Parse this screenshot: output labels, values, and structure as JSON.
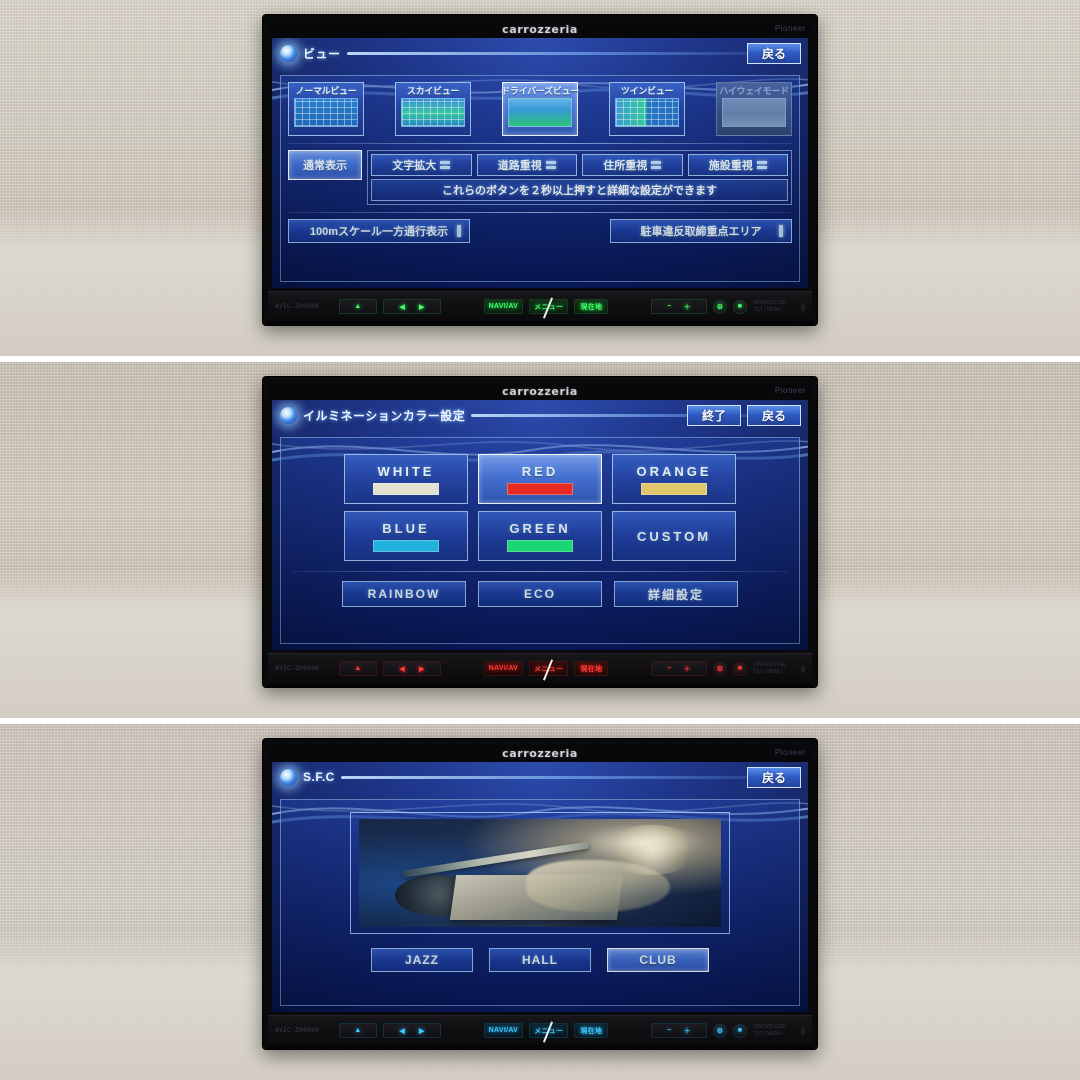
{
  "device": {
    "brand": "carrozzeria",
    "maker": "Pioneer",
    "model": "AVIC-ZH9000"
  },
  "faceplate": {
    "eject_label": "▲",
    "seek_back_label": "◀",
    "seek_fwd_label": "▶",
    "naviav_label": "NAVI/AV",
    "menu_label": "メニュー",
    "current_label": "現在地",
    "vol_down_label": "−",
    "vol_up_label": "＋",
    "round_a_label": "⚙",
    "round_b_label": "■",
    "tiny_text_1": "OPEN/CLOSE",
    "tiny_text_2": "TILT / MENU"
  },
  "panel1": {
    "title": "ビュー",
    "back_label": "戻る",
    "views": [
      {
        "label": "ノーマルビュー",
        "thumb": "th-normal",
        "state": "normal"
      },
      {
        "label": "スカイビュー",
        "thumb": "th-sky",
        "state": "normal"
      },
      {
        "label": "ドライバーズビュー",
        "thumb": "th-driver",
        "state": "selected"
      },
      {
        "label": "ツインビュー",
        "thumb": "th-twin",
        "state": "normal"
      },
      {
        "label": "ハイウェイモード",
        "thumb": "th-hw",
        "state": "disabled"
      }
    ],
    "normal_display_label": "通常表示",
    "chips": [
      {
        "label": "文字拡大"
      },
      {
        "label": "道路重視"
      },
      {
        "label": "住所重視"
      },
      {
        "label": "施設重視"
      }
    ],
    "hint": "これらのボタンを２秒以上押すと詳細な設定ができます",
    "wide_left_label": "100mスケール一方通行表示",
    "wide_right_label": "駐車違反取締重点エリア",
    "illumination": "green"
  },
  "panel2": {
    "title": "イルミネーションカラー設定",
    "finish_label": "終了",
    "back_label": "戻る",
    "colors": [
      {
        "label": "WHITE",
        "swatch": "#f2f0dc",
        "state": "normal"
      },
      {
        "label": "RED",
        "swatch": "#f52118",
        "state": "selected"
      },
      {
        "label": "ORANGE",
        "swatch": "#f0d36a",
        "state": "normal"
      },
      {
        "label": "BLUE",
        "swatch": "#1ec5f7",
        "state": "normal"
      },
      {
        "label": "GREEN",
        "swatch": "#15ef7e",
        "state": "normal"
      },
      {
        "label": "CUSTOM",
        "swatch": "",
        "state": "normal"
      }
    ],
    "bottom": [
      {
        "label": "RAINBOW"
      },
      {
        "label": "ECO"
      },
      {
        "label": "詳細設定"
      }
    ],
    "illumination": "red"
  },
  "panel3": {
    "title": "S.F.C",
    "back_label": "戻る",
    "photo_caption": "dj-turntable-photo",
    "modes": [
      {
        "label": "JAZZ",
        "state": "normal"
      },
      {
        "label": "HALL",
        "state": "normal"
      },
      {
        "label": "CLUB",
        "state": "selected"
      }
    ],
    "illumination": "blue"
  }
}
